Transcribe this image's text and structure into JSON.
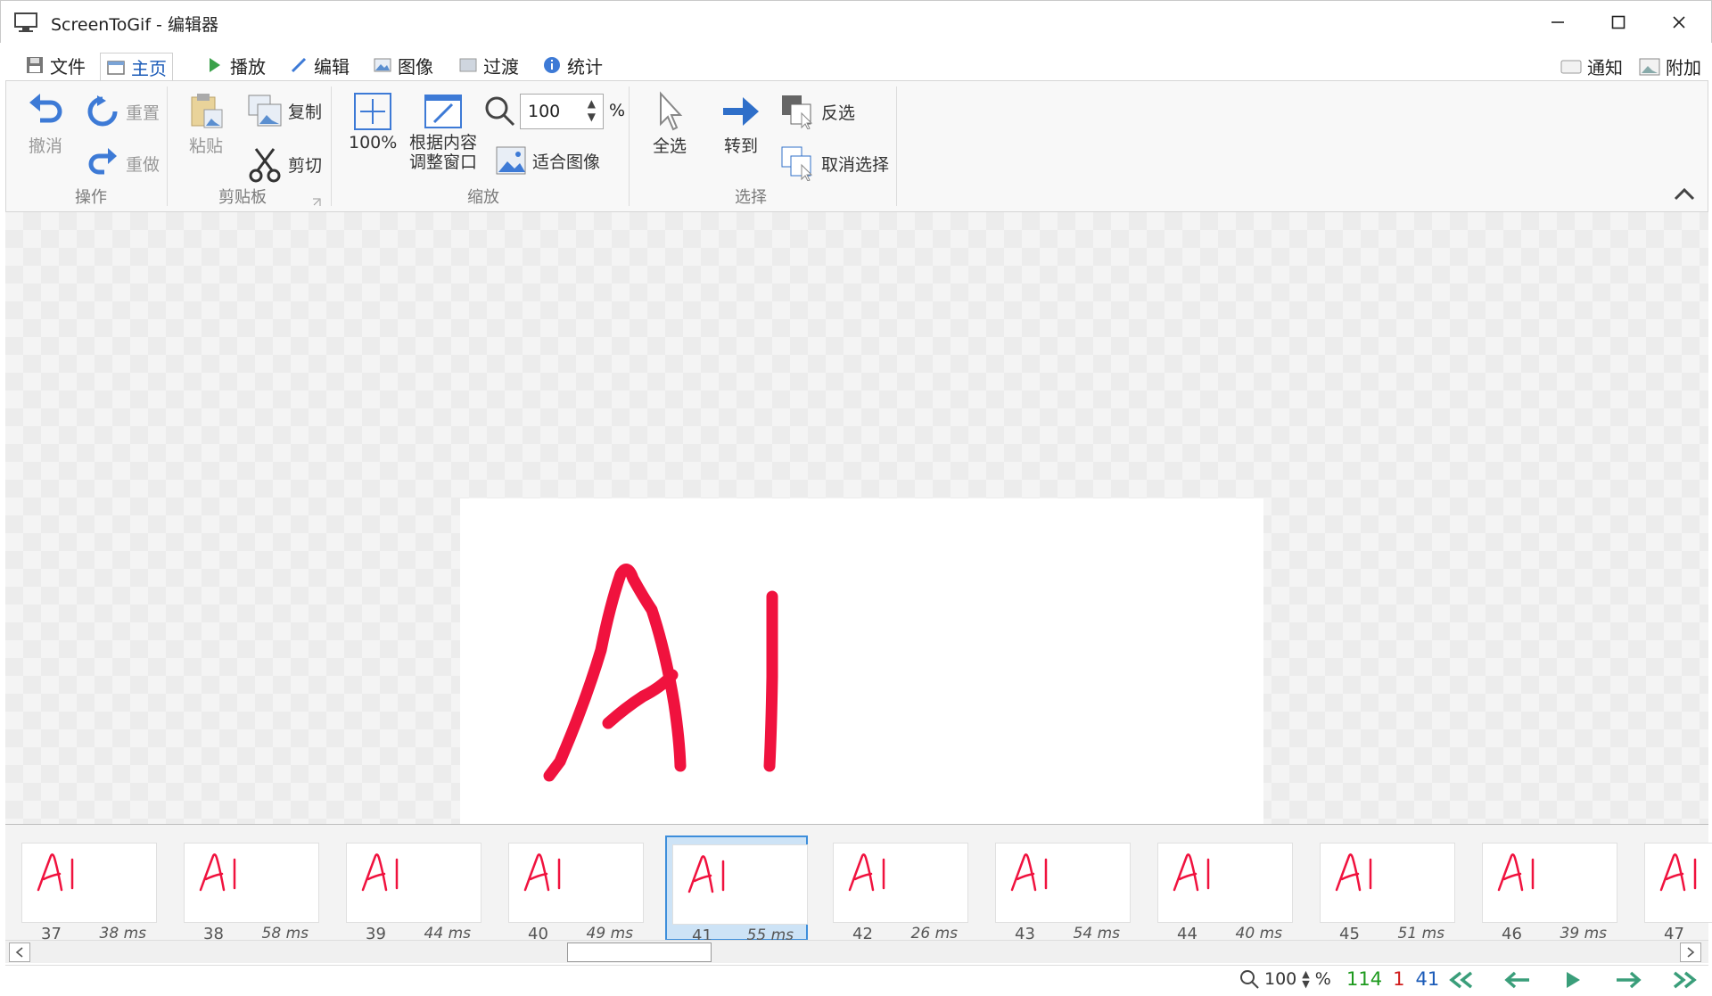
{
  "window": {
    "title": "ScreenToGif - 编辑器",
    "minimize": "—",
    "maximize": "☐",
    "close": "✕"
  },
  "tabs": [
    {
      "label": "文件",
      "icon": "save-icon"
    },
    {
      "label": "主页",
      "icon": "home-icon",
      "active": true
    },
    {
      "label": "播放",
      "icon": "play-icon"
    },
    {
      "label": "编辑",
      "icon": "pencil-icon"
    },
    {
      "label": "图像",
      "icon": "image-icon"
    },
    {
      "label": "过渡",
      "icon": "transition-icon"
    },
    {
      "label": "统计",
      "icon": "info-icon"
    }
  ],
  "right_tabs": {
    "notify": "通知",
    "extras": "附加"
  },
  "ribbon": {
    "actions": {
      "undo": "撤消",
      "reset": "重置",
      "redo": "重做",
      "group": "操作"
    },
    "clipboard": {
      "paste": "粘贴",
      "copy": "复制",
      "cut": "剪切",
      "group": "剪贴板"
    },
    "zoom": {
      "hundred": "100%",
      "fit_window_line1": "根据内容",
      "fit_window_line2": "调整窗口",
      "zoom_value": "100",
      "percent": "%",
      "fit_image": "适合图像",
      "group": "缩放"
    },
    "select": {
      "select_all": "全选",
      "goto": "转到",
      "invert": "反选",
      "deselect": "取消选择",
      "group": "选择"
    }
  },
  "canvas": {
    "drawing_text": "AI",
    "stroke_color": "#f0123e"
  },
  "frames": [
    {
      "num": "37",
      "dur": "38 ms"
    },
    {
      "num": "38",
      "dur": "58 ms"
    },
    {
      "num": "39",
      "dur": "44 ms"
    },
    {
      "num": "40",
      "dur": "49 ms"
    },
    {
      "num": "41",
      "dur": "55 ms",
      "selected": true
    },
    {
      "num": "42",
      "dur": "26 ms"
    },
    {
      "num": "43",
      "dur": "54 ms"
    },
    {
      "num": "44",
      "dur": "40 ms"
    },
    {
      "num": "45",
      "dur": "51 ms"
    },
    {
      "num": "46",
      "dur": "39 ms"
    },
    {
      "num": "47",
      "dur": ""
    }
  ],
  "status": {
    "zoom": "100",
    "percent": "%",
    "total_frames": "114",
    "selected_count": "1",
    "current_frame": "41",
    "colors": {
      "total": "#1e9a1e",
      "selected": "#d01c1c",
      "current": "#1b5bb8"
    }
  }
}
